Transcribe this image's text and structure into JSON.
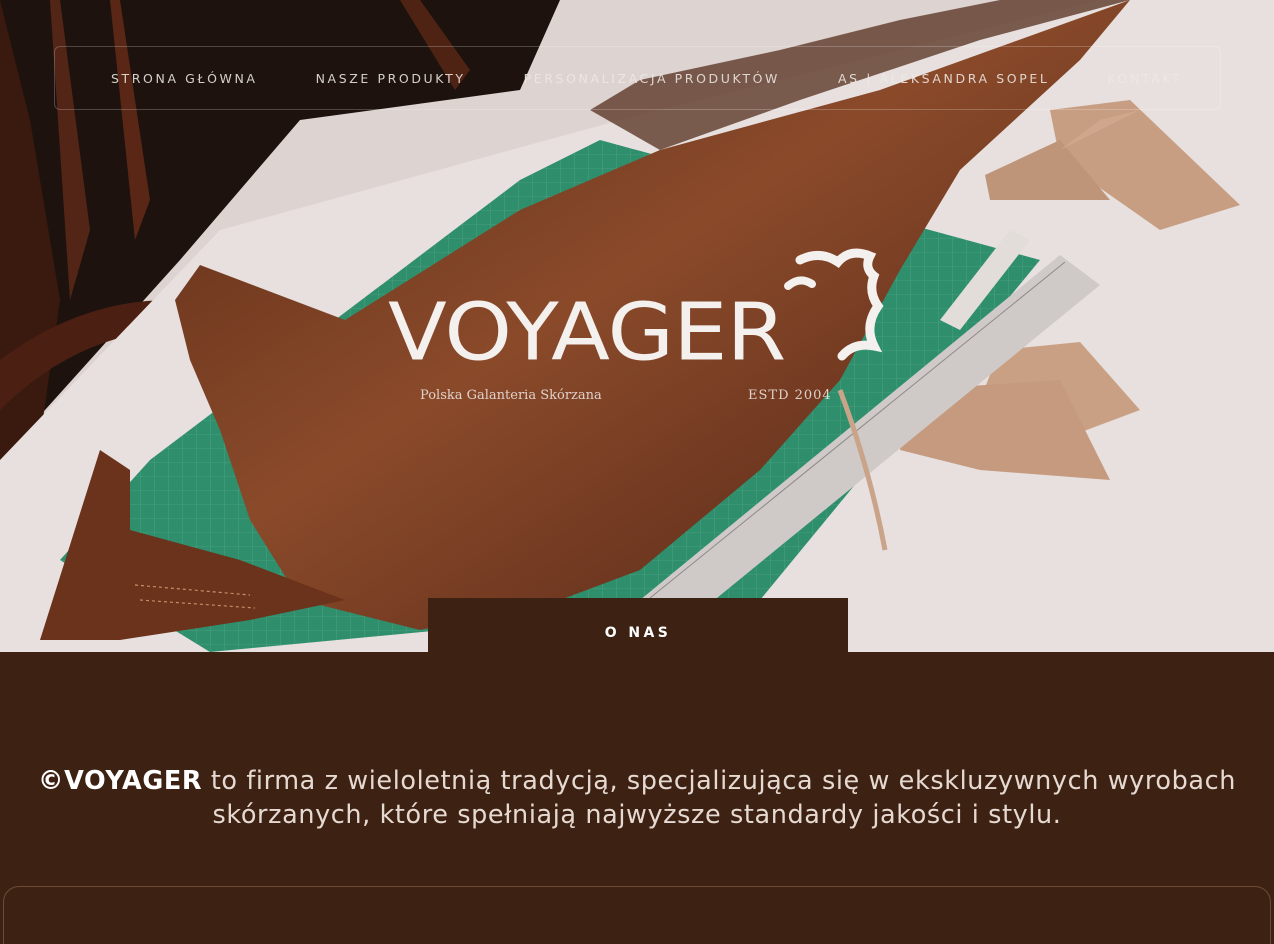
{
  "nav": {
    "items": [
      "STRONA GŁÓWNA",
      "NASZE PRODUKTY",
      "PERSONALIZACJA PRODUKTÓW",
      "AS | ALEKSANDRA SOPEL",
      "KONTAKT"
    ]
  },
  "logo": {
    "brand": "VOYAGER",
    "tagline": "Polska Galanteria Skórzana",
    "estd": "ESTD 2004"
  },
  "about": {
    "tab_label": "O NAS",
    "brand_mark": "©VOYAGER",
    "line1_rest": " to firma z wieloletnią tradycją, specjalizująca się w ekskluzywnych wyrobach",
    "line2": "skórzanych, które spełniają najwyższe standardy jakości i stylu."
  },
  "colors": {
    "background": "#3d2213",
    "leather": "#7a3f22",
    "mat": "#2f8f6c"
  }
}
